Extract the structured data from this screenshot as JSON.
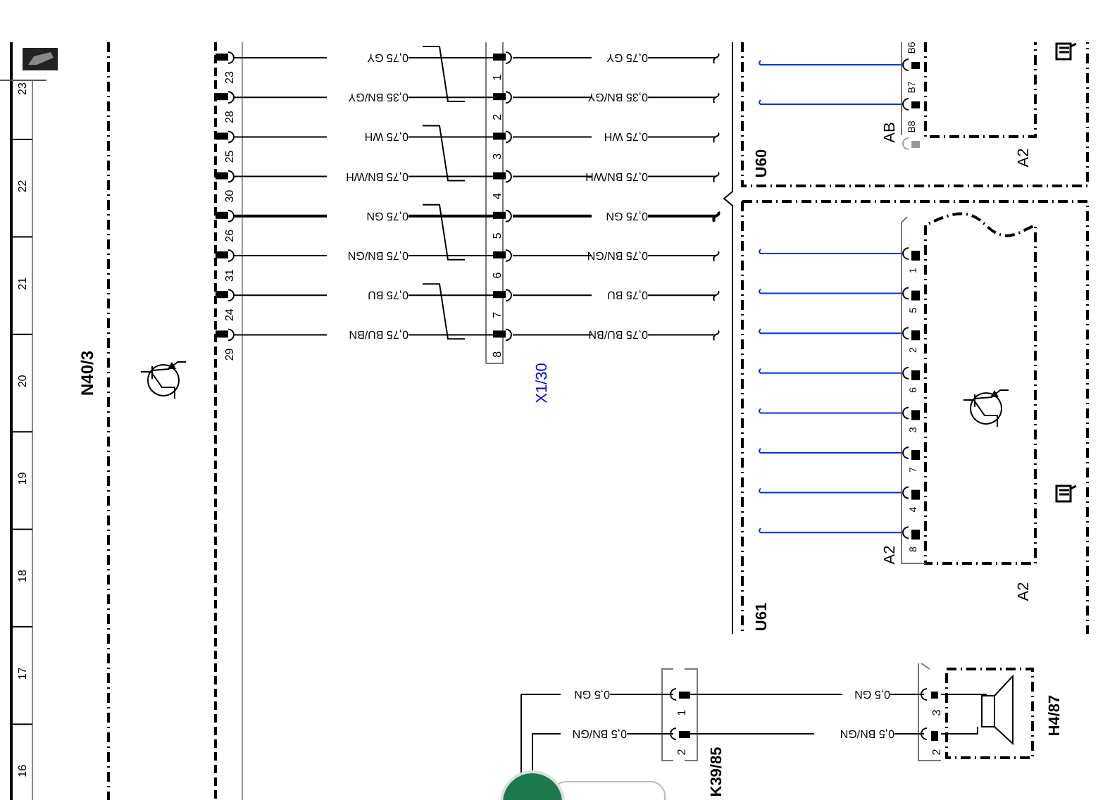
{
  "ruler": {
    "marks": [
      "23",
      "22",
      "21",
      "20",
      "19",
      "18",
      "17",
      "16"
    ]
  },
  "control_unit": {
    "label": "N40/3"
  },
  "harness": {
    "connector": "X1/30",
    "wires": [
      {
        "unit_pin": "23",
        "left_label": "0,75 GY",
        "connector_pin": "1",
        "right_label": "0,75 GY",
        "bold": false
      },
      {
        "unit_pin": "28",
        "left_label": "0,35 BN/GY",
        "connector_pin": "2",
        "right_label": "0,35 BN/GY",
        "bold": false
      },
      {
        "unit_pin": "25",
        "left_label": "0,75 WH",
        "connector_pin": "3",
        "right_label": "0,75 WH",
        "bold": false
      },
      {
        "unit_pin": "30",
        "left_label": "0,75 BN/WH",
        "connector_pin": "4",
        "right_label": "0,75 BN/WH",
        "bold": false
      },
      {
        "unit_pin": "26",
        "left_label": "0,75 GN",
        "connector_pin": "5",
        "right_label": "0,75 GN",
        "bold": true
      },
      {
        "unit_pin": "31",
        "left_label": "0,75 BN/GN",
        "connector_pin": "6",
        "right_label": "0,75 BN/GN",
        "bold": false
      },
      {
        "unit_pin": "24",
        "left_label": "0,75 BU",
        "connector_pin": "7",
        "right_label": "0,75 BU",
        "bold": false
      },
      {
        "unit_pin": "29",
        "left_label": "0,75 BU/BN",
        "connector_pin": "8",
        "right_label": "0,75 BU/BN",
        "bold": false
      }
    ]
  },
  "u60": {
    "label": "U60",
    "connector": "AB",
    "module": "A2",
    "pins": [
      {
        "label": "B6",
        "wired": true
      },
      {
        "label": "B7",
        "wired": true
      },
      {
        "label": "B8",
        "wired": false
      }
    ]
  },
  "u61": {
    "label": "U61",
    "connector": "A2",
    "module": "A2",
    "pins": [
      {
        "label": "1",
        "wired": true
      },
      {
        "label": "5",
        "wired": true
      },
      {
        "label": "2",
        "wired": true
      },
      {
        "label": "6",
        "wired": true
      },
      {
        "label": "3",
        "wired": true
      },
      {
        "label": "7",
        "wired": true
      },
      {
        "label": "4",
        "wired": true
      },
      {
        "label": "8",
        "wired": true
      }
    ]
  },
  "horn_circuit": {
    "connector": "K39/85",
    "device": "H4/87",
    "wires": [
      {
        "left_label": "0,5 GN",
        "connector_pin": "1",
        "right_label": "0,5 GN",
        "device_pin": "3"
      },
      {
        "left_label": "0,5 BN/GN",
        "connector_pin": "2",
        "right_label": "0,5 BN/GN",
        "device_pin": "2"
      }
    ]
  }
}
